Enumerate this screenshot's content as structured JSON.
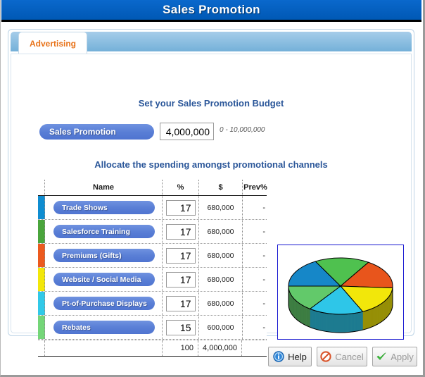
{
  "window": {
    "title": "Sales Promotion"
  },
  "tabs": [
    {
      "label": "Advertising",
      "active": true
    }
  ],
  "budget": {
    "heading": "Set your Sales Promotion Budget",
    "pill_label": "Sales Promotion",
    "value": "4,000,000",
    "range_hint": "0 - 10,000,000"
  },
  "allocation": {
    "heading": "Allocate the spending amongst promotional channels",
    "columns": [
      "Name",
      "%",
      "$",
      "Prev%"
    ],
    "rows": [
      {
        "name": "Trade Shows",
        "pct": "17",
        "dollars": "680,000",
        "prev": "-",
        "color": "#0f8dd1"
      },
      {
        "name": "Salesforce Training",
        "pct": "17",
        "dollars": "680,000",
        "prev": "-",
        "color": "#4aa53c"
      },
      {
        "name": "Premiums (Gifts)",
        "pct": "17",
        "dollars": "680,000",
        "prev": "-",
        "color": "#ec5a1e"
      },
      {
        "name": "Website / Social Media",
        "pct": "17",
        "dollars": "680,000",
        "prev": "-",
        "color": "#f2e70a"
      },
      {
        "name": "Pt-of-Purchase Displays",
        "pct": "17",
        "dollars": "680,000",
        "prev": "-",
        "color": "#31c9e8"
      },
      {
        "name": "Rebates",
        "pct": "15",
        "dollars": "600,000",
        "prev": "-",
        "color": "#74d678"
      }
    ],
    "total": {
      "pct": "100",
      "dollars": "4,000,000"
    }
  },
  "chart_data": {
    "type": "pie",
    "title": "",
    "three_d": true,
    "categories": [
      "Trade Shows",
      "Salesforce Training",
      "Premiums (Gifts)",
      "Website / Social Media",
      "Pt-of-Purchase Displays",
      "Rebates"
    ],
    "values": [
      17,
      17,
      17,
      17,
      17,
      15
    ],
    "value_unit": "%",
    "colors": [
      "#1687c8",
      "#4fc14f",
      "#e8551c",
      "#f2e70a",
      "#2ec6e8",
      "#62c96a"
    ],
    "legend": "none",
    "labels_shown": false
  },
  "footer": {
    "buttons": [
      {
        "label": "Help",
        "icon": "info-icon",
        "enabled": true
      },
      {
        "label": "Cancel",
        "icon": "cancel-icon",
        "enabled": false
      },
      {
        "label": "Apply",
        "icon": "check-icon",
        "enabled": false
      }
    ]
  },
  "colors": {
    "titlebar": "#0560c0",
    "tab_text": "#e8731a",
    "heading": "#2a5699",
    "pill": "#5a7fd6",
    "pie_border": "#1616d0"
  }
}
